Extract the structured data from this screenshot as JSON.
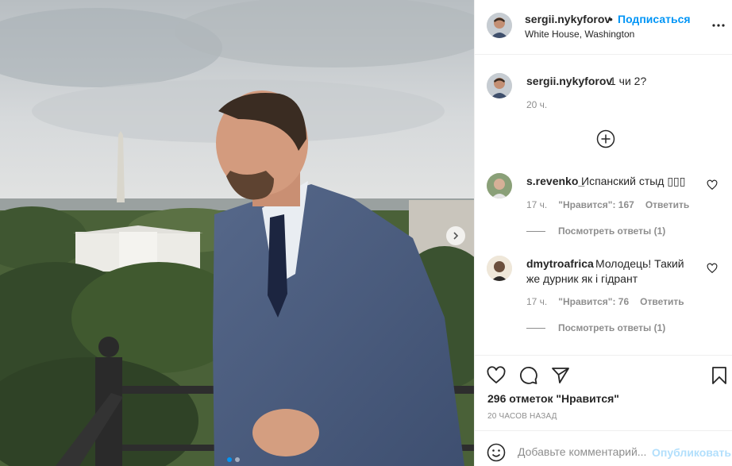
{
  "post": {
    "username": "sergii.nykyforov",
    "separator": "•",
    "follow_label": "Подписаться",
    "location": "White House, Washington",
    "caption": "1 чи 2?",
    "caption_time": "20 ч.",
    "likes": "296 отметок \"Нравится\"",
    "time_ago": "20 ЧАСОВ НАЗАД"
  },
  "comments": [
    {
      "username": "s.revenko_",
      "text": "Испанский стыд ▯▯▯",
      "time": "17 ч.",
      "likes": "\"Нравится\": 167",
      "reply_label": "Ответить",
      "view_replies": "Посмотреть ответы (1)"
    },
    {
      "username": "dmytroafrica",
      "text_line1": "Молодець! Такий",
      "text_line2": "же дурник як і гідрант",
      "time": "17 ч.",
      "likes": "\"Нравится\": 76",
      "reply_label": "Ответить",
      "view_replies": "Посмотреть ответы (1)"
    }
  ],
  "add_comment": {
    "placeholder": "Добавьте комментарий...",
    "post_label": "Опубликовать"
  },
  "carousel": {
    "slides": 2,
    "active": 1
  },
  "colors": {
    "accent": "#0095f6",
    "muted": "#8e8e8e",
    "text": "#262626",
    "post_disabled": "#b2dffc"
  },
  "icons": [
    "more-options-icon",
    "add-circle-icon",
    "heart-icon",
    "comment-icon",
    "share-icon",
    "bookmark-icon",
    "emoji-icon",
    "chevron-right-icon"
  ]
}
